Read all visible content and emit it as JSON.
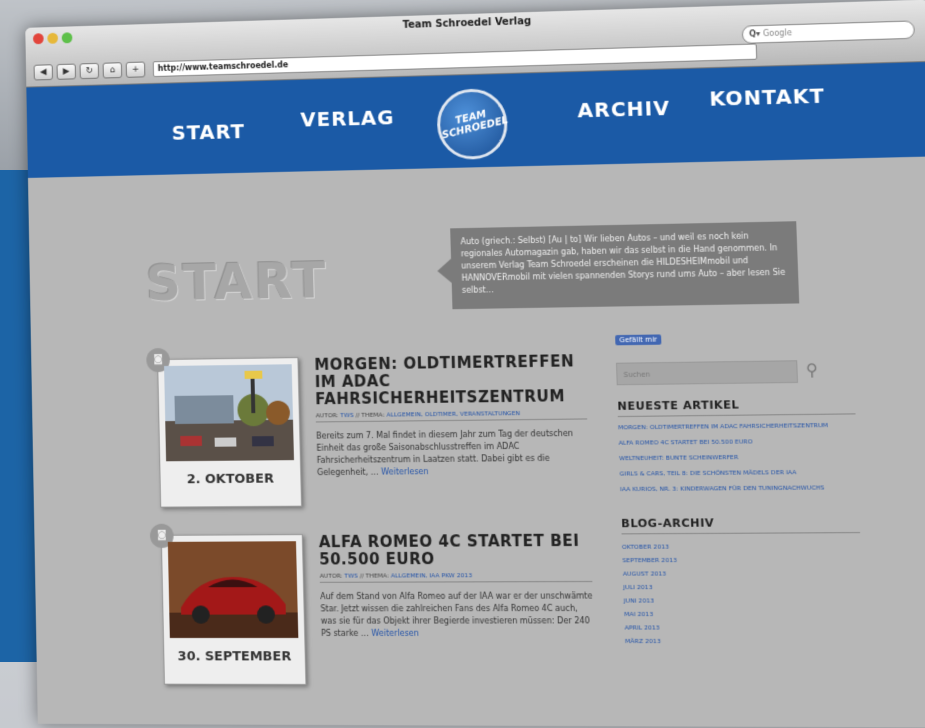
{
  "window": {
    "title": "Team Schroedel Verlag"
  },
  "browser": {
    "url": "http://www.teamschroedel.de",
    "search_placeholder": "Google",
    "search_prefix": "Q▾",
    "back": "◀",
    "forward": "▶",
    "reload": "↻",
    "home": "⌂",
    "add": "+"
  },
  "nav": {
    "start": "START",
    "verlag": "VERLAG",
    "logo": "TEAM SCHROEDEL",
    "archiv": "ARCHIV",
    "kontakt": "KONTAKT"
  },
  "page": {
    "title": "START",
    "intro": "Auto (griech.: Selbst) [Au | to] Wir lieben Autos – und weil es noch kein regionales Automagazin gab, haben wir das selbst in die Hand genommen. In unserem Verlag Team Schroedel erscheinen die HILDESHEIMmobil und HANNOVERmobil mit vielen spannenden Storys rund ums Auto – aber lesen Sie selbst…"
  },
  "posts": [
    {
      "date": "2. OKTOBER",
      "title": "MORGEN: OLDTIMERTREFFEN IM ADAC FAHRSICHERHEITSZENTRUM",
      "meta_prefix": "AUTOR:",
      "author": "TWS",
      "meta_thema": "// THEMA:",
      "tags": "ALLGEMEIN, OLDTIMER, VERANSTALTUNGEN",
      "excerpt": "Bereits zum 7. Mal findet in diesem Jahr zum Tag der deutschen Einheit das große Saisonabschlusstreffen im ADAC Fahrsicherheitszentrum in Laatzen statt. Dabei gibt es die Gelegenheit, …",
      "more": "Weiterlesen"
    },
    {
      "date": "30. SEPTEMBER",
      "title": "ALFA ROMEO 4C STARTET BEI 50.500 EURO",
      "meta_prefix": "AUTOR:",
      "author": "TWS",
      "meta_thema": "// THEMA:",
      "tags": "ALLGEMEIN, IAA PKW 2013",
      "excerpt": "Auf dem Stand von Alfa Romeo auf der IAA war er der unschwämte Star. Jetzt wissen die zahlreichen Fans des Alfa Romeo 4C auch, was sie für das Objekt ihrer Begierde investieren müssen: Der 240 PS starke …",
      "more": "Weiterlesen"
    }
  ],
  "sidebar": {
    "fb_like": "Gefällt mir",
    "search_placeholder": "Suchen",
    "latest_heading": "NEUESTE ARTIKEL",
    "latest": [
      "MORGEN: OLDTIMERTREFFEN IM ADAC FAHRSICHERHEITSZENTRUM",
      "ALFA ROMEO 4C STARTET BEI 50.500 EURO",
      "WELTNEUHEIT: BUNTE SCHEINWERFER",
      "GIRLS & CARS, TEIL 8: DIE SCHÖNSTEN MÄDELS DER IAA",
      "IAA KURIOS, NR. 3: KINDERWAGEN FÜR DEN TUNINGNACHWUCHS"
    ],
    "archive_heading": "BLOG-ARCHIV",
    "archive": [
      "OKTOBER 2013",
      "SEPTEMBER 2013",
      "AUGUST 2013",
      "JULI 2013",
      "JUNI 2013",
      "MAI 2013",
      "APRIL 2013",
      "MÄRZ 2013"
    ]
  },
  "colors": {
    "nav_blue": "#1b5aa6",
    "link_blue": "#2554a8",
    "content_grey": "#b7b7b7"
  }
}
